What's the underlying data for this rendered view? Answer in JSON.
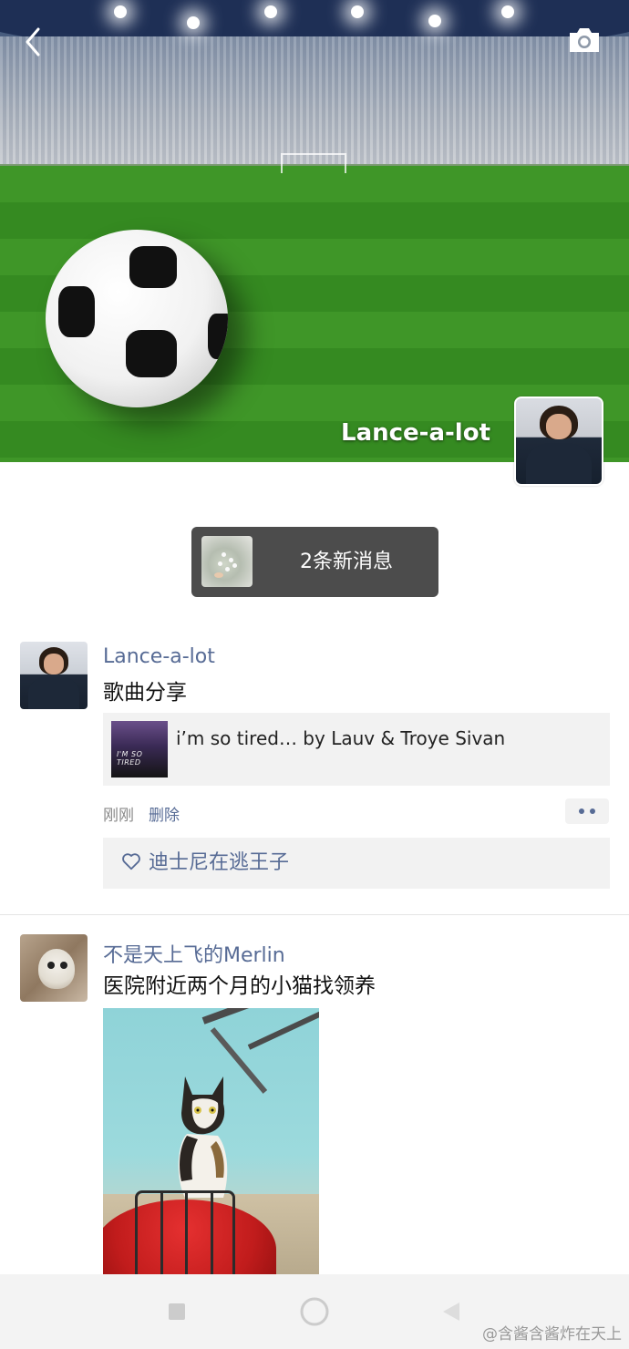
{
  "header": {
    "back_icon": "chevron-left-icon",
    "camera_icon": "camera-icon",
    "owner_name": "Lance-a-lot"
  },
  "new_messages": {
    "label": "2条新消息"
  },
  "posts": [
    {
      "author": "Lance-a-lot",
      "text": "歌曲分享",
      "share": {
        "cover_text": "I'M SO TIRED",
        "title": "i’m so tired… by Lauv & Troye Sivan"
      },
      "time": "刚刚",
      "delete_label": "删除",
      "likes": "迪士尼在逃王子"
    },
    {
      "author": "不是天上飞的Merlin",
      "text": "医院附近两个月的小猫找领养"
    }
  ],
  "watermark": "@含酱含酱炸在天上",
  "colors": {
    "name_blue": "#576b95",
    "pill_bg": "#4c4c4c",
    "card_bg": "#f2f2f2"
  }
}
